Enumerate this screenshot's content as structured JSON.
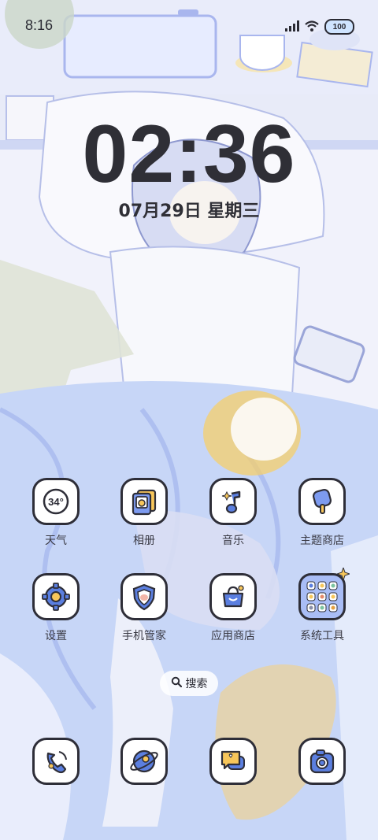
{
  "status_bar": {
    "time": "8:16",
    "battery": "100"
  },
  "lock_clock": {
    "time": "02:36",
    "date": "07月29日 星期三"
  },
  "apps": [
    {
      "label": "天气",
      "icon": "weather-icon",
      "badge": "34°"
    },
    {
      "label": "相册",
      "icon": "gallery-icon"
    },
    {
      "label": "音乐",
      "icon": "music-icon"
    },
    {
      "label": "主题商店",
      "icon": "theme-store-icon"
    },
    {
      "label": "设置",
      "icon": "settings-icon"
    },
    {
      "label": "手机管家",
      "icon": "security-icon"
    },
    {
      "label": "应用商店",
      "icon": "app-store-icon"
    },
    {
      "label": "系统工具",
      "icon": "system-tools-folder-icon"
    }
  ],
  "search": {
    "label": "搜索"
  },
  "dock": [
    {
      "icon": "phone-icon"
    },
    {
      "icon": "browser-icon"
    },
    {
      "icon": "messages-icon"
    },
    {
      "icon": "camera-icon"
    }
  ],
  "colors": {
    "outline": "#2e2e38",
    "accent_blue": "#5b7fe0",
    "accent_yellow": "#f7c65a",
    "background": "#eef0fb"
  }
}
